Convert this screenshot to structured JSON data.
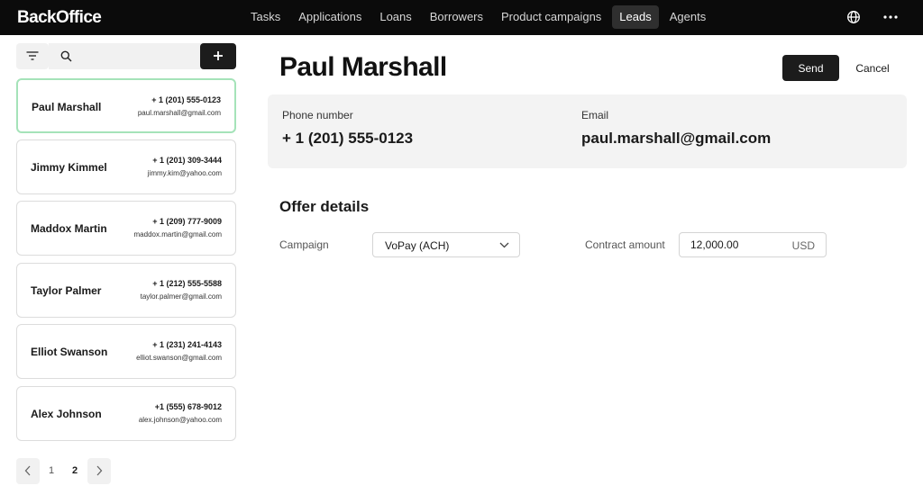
{
  "app": {
    "brand": "BackOffice"
  },
  "nav": {
    "items": [
      {
        "label": "Tasks"
      },
      {
        "label": "Applications"
      },
      {
        "label": "Loans"
      },
      {
        "label": "Borrowers"
      },
      {
        "label": "Product campaigns"
      },
      {
        "label": "Leads",
        "active": true
      },
      {
        "label": "Agents"
      }
    ],
    "icons": [
      "globe-icon",
      "more-icon"
    ]
  },
  "sidebar": {
    "search": {
      "value": "",
      "placeholder": ""
    },
    "leads": [
      {
        "name": "Paul Marshall",
        "phone": "+ 1 (201) 555-0123",
        "email": "paul.marshall@gmail.com",
        "selected": true
      },
      {
        "name": "Jimmy Kimmel",
        "phone": "+ 1 (201) 309-3444",
        "email": "jimmy.kim@yahoo.com"
      },
      {
        "name": "Maddox Martin",
        "phone": "+ 1 (209) 777-9009",
        "email": "maddox.martin@gmail.com"
      },
      {
        "name": "Taylor Palmer",
        "phone": "+ 1 (212) 555-5588",
        "email": "taylor.palmer@gmail.com"
      },
      {
        "name": "Elliot Swanson",
        "phone": "+ 1 (231) 241-4143",
        "email": "elliot.swanson@gmail.com"
      },
      {
        "name": "Alex Johnson",
        "phone": "+1 (555) 678-9012",
        "email": "alex.johnson@yahoo.com"
      }
    ],
    "pagination": {
      "pages": [
        "1",
        "2"
      ],
      "current": "2"
    }
  },
  "detail": {
    "title": "Paul Marshall",
    "send_label": "Send",
    "cancel_label": "Cancel",
    "contact": {
      "phone_label": "Phone number",
      "phone_value": "+ 1 (201) 555-0123",
      "email_label": "Email",
      "email_value": "paul.marshall@gmail.com"
    },
    "offer": {
      "section_title": "Offer details",
      "campaign_label": "Campaign",
      "campaign_value": "VoPay (ACH)",
      "amount_label": "Contract amount",
      "amount_value": "12,000.00",
      "amount_unit": "USD"
    }
  },
  "colors": {
    "topbar": "#0b0b0b",
    "selected_border": "#a5e3b9",
    "primary_button": "#1c1c1c",
    "panel_bg": "#f3f3f3"
  }
}
